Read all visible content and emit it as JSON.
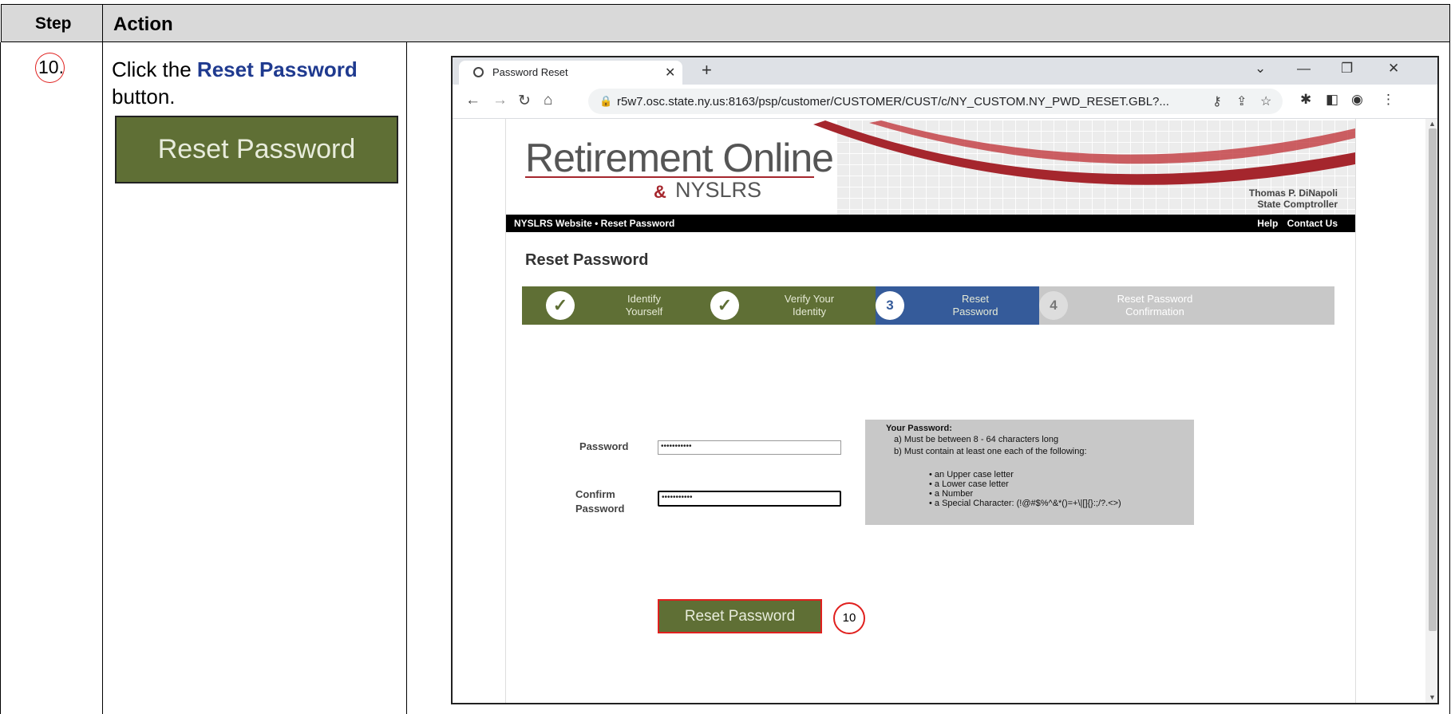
{
  "table": {
    "header_step": "Step",
    "header_action": "Action",
    "step_number": "10.",
    "instruction_prefix": "Click the ",
    "instruction_target": "Reset Password",
    "instruction_suffix": " button.",
    "button_sample_label": "Reset Password"
  },
  "browser": {
    "tab_title": "Password Reset",
    "url": "r5w7.osc.state.ny.us:8163/psp/customer/CUSTOMER/CUST/c/NY_CUSTOM.NY_PWD_RESET.GBL?...",
    "new_tab_label": "+"
  },
  "page": {
    "logo_main": "Retirement Online",
    "logo_sub": "NYSLRS",
    "comptroller_name": "Thomas P. DiNapoli",
    "comptroller_title": "State Comptroller",
    "breadcrumb": "NYSLRS Website • Reset Password",
    "nav_help": "Help",
    "nav_contact": "Contact Us",
    "title": "Reset Password",
    "steps": [
      {
        "badge": "✓",
        "label_line1": "Identify",
        "label_line2": "Yourself",
        "state": "done"
      },
      {
        "badge": "✓",
        "label_line1": "Verify Your",
        "label_line2": "Identity",
        "state": "done"
      },
      {
        "badge": "3",
        "label_line1": "Reset",
        "label_line2": "Password",
        "state": "active"
      },
      {
        "badge": "4",
        "label_line1": "Reset Password",
        "label_line2": "Confirmation",
        "state": "future"
      }
    ],
    "password_label": "Password",
    "password_value": "•••••••••••",
    "confirm_label_line1": "Confirm",
    "confirm_label_line2": "Password",
    "confirm_value": "•••••••••••",
    "requirements": {
      "title": "Your Password:",
      "rule_a": "a) Must be between 8 - 64 characters long",
      "rule_b": "b) Must contain at least one each of the following:",
      "items": [
        "•  an Upper case letter",
        "•  a Lower case letter",
        "•  a Number",
        "•  a Special Character: (!@#$%^&*()=+\\|[]{}:;/?.<>)"
      ]
    },
    "reset_button_label": "Reset Password",
    "callout_number": "10"
  },
  "colors": {
    "olive": "#5f6f35",
    "active_blue": "#355b9a",
    "highlight_red": "#e0201e",
    "brand_red": "#a5262d"
  }
}
